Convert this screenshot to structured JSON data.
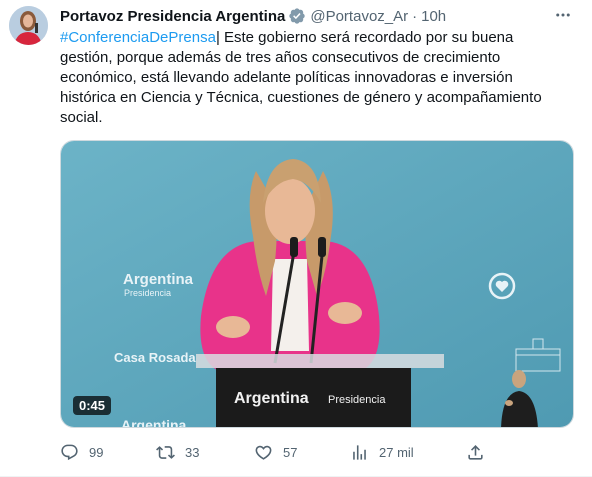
{
  "author": {
    "display_name": "Portavoz Presidencia Argentina",
    "handle": "@Portavoz_Ar",
    "separator": "·",
    "time": "10h",
    "verified_icon": "verified-badge-icon"
  },
  "tweet": {
    "hashtag": "#ConferenciaDePrensa",
    "body": "| Este gobierno será recordado por su buena gestión, porque además de tres años consecutivos de crecimiento económico, está llevando adelante políticas innovadoras e inversión histórica en Ciencia y Técnica, cuestiones de género y acompañamiento social."
  },
  "media": {
    "duration": "0:45",
    "backdrop_texts": {
      "argentina_left": "Argentina",
      "presidencia_left": "Presidencia",
      "casa_rosada": "Casa Rosada",
      "argentina_bottom": "Argentina",
      "podium_argentina": "Argentina",
      "podium_presidencia": "Presidencia"
    }
  },
  "actions": {
    "replies": "99",
    "retweets": "33",
    "likes": "57",
    "views": "27 mil"
  },
  "colors": {
    "link": "#1d9bf0",
    "secondary_text": "#536471",
    "verified": "#829aab",
    "backdrop": "#5fa7bd",
    "jacket": "#e8338a"
  }
}
